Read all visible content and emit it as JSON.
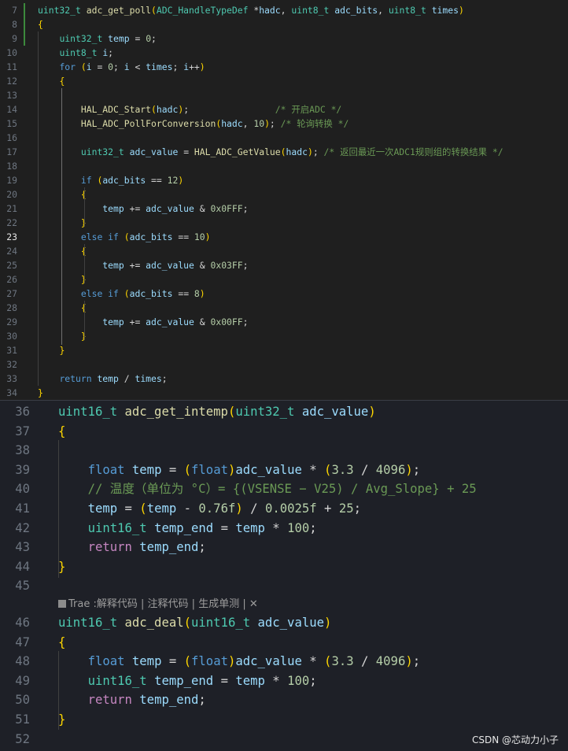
{
  "editor_top": {
    "current_line": "23",
    "lines": [
      {
        "n": "7",
        "t": "uint32_t adc_get_poll(ADC_HandleTypeDef *hadc, uint8_t adc_bits, uint8_t times)"
      },
      {
        "n": "8",
        "t": "{"
      },
      {
        "n": "9",
        "t": "    uint32_t temp = 0;"
      },
      {
        "n": "10",
        "t": "    uint8_t i;"
      },
      {
        "n": "11",
        "t": "    for (i = 0; i < times; i++)"
      },
      {
        "n": "12",
        "t": "    {"
      },
      {
        "n": "13",
        "t": ""
      },
      {
        "n": "14",
        "t": "        HAL_ADC_Start(hadc);                /* 开启ADC */"
      },
      {
        "n": "15",
        "t": "        HAL_ADC_PollForConversion(hadc, 10); /* 轮询转换 */"
      },
      {
        "n": "16",
        "t": ""
      },
      {
        "n": "17",
        "t": "        uint32_t adc_value = HAL_ADC_GetValue(hadc); /* 返回最近一次ADC1规则组的转换结果 */"
      },
      {
        "n": "18",
        "t": ""
      },
      {
        "n": "19",
        "t": "        if (adc_bits == 12)"
      },
      {
        "n": "20",
        "t": "        {"
      },
      {
        "n": "21",
        "t": "            temp += adc_value & 0x0FFF;"
      },
      {
        "n": "22",
        "t": "        }"
      },
      {
        "n": "23",
        "t": "        else if (adc_bits == 10)"
      },
      {
        "n": "24",
        "t": "        {"
      },
      {
        "n": "25",
        "t": "            temp += adc_value & 0x03FF;"
      },
      {
        "n": "26",
        "t": "        }"
      },
      {
        "n": "27",
        "t": "        else if (adc_bits == 8)"
      },
      {
        "n": "28",
        "t": "        {"
      },
      {
        "n": "29",
        "t": "            temp += adc_value & 0x00FF;"
      },
      {
        "n": "30",
        "t": "        }"
      },
      {
        "n": "31",
        "t": "    }"
      },
      {
        "n": "32",
        "t": ""
      },
      {
        "n": "33",
        "t": "    return temp / times;"
      },
      {
        "n": "34",
        "t": "}"
      }
    ]
  },
  "editor_bottom": {
    "lines": [
      {
        "n": "36",
        "t": "uint16_t adc_get_intemp(uint32_t adc_value)"
      },
      {
        "n": "37",
        "t": "{"
      },
      {
        "n": "38",
        "t": ""
      },
      {
        "n": "39",
        "t": "    float temp = (float)adc_value * (3.3 / 4096);"
      },
      {
        "n": "40",
        "t": "    // 温度（单位为 °C）= {(VSENSE − V25) / Avg_Slope} + 25"
      },
      {
        "n": "41",
        "t": "    temp = (temp - 0.76f) / 0.0025f + 25;"
      },
      {
        "n": "42",
        "t": "    uint16_t temp_end = temp * 100;"
      },
      {
        "n": "43",
        "t": "    return temp_end;"
      },
      {
        "n": "44",
        "t": "}"
      },
      {
        "n": "45",
        "t": ""
      },
      {
        "n": "46",
        "t": "uint16_t adc_deal(uint16_t adc_value)"
      },
      {
        "n": "47",
        "t": "{"
      },
      {
        "n": "48",
        "t": "    float temp = (float)adc_value * (3.3 / 4096);"
      },
      {
        "n": "49",
        "t": "    uint16_t temp_end = temp * 100;"
      },
      {
        "n": "50",
        "t": "    return temp_end;"
      },
      {
        "n": "51",
        "t": "}"
      },
      {
        "n": "52",
        "t": ""
      }
    ],
    "codelens": {
      "prefix": "Trae :",
      "explain": "解释代码",
      "sep1": " | ",
      "comment": "注释代码",
      "sep2": " | ",
      "unittest": "生成单测",
      "sep3": " | ",
      "close": "✕"
    }
  },
  "watermark": "CSDN @芯动力小子",
  "colors": {
    "type": "#4ec9b0",
    "keyword": "#c586c0",
    "function": "#dcdcaa",
    "variable": "#9cdcfe",
    "number": "#b5cea8",
    "comment": "#6a9955",
    "bracket1": "#ffd700",
    "bracket2": "#da70d6"
  }
}
